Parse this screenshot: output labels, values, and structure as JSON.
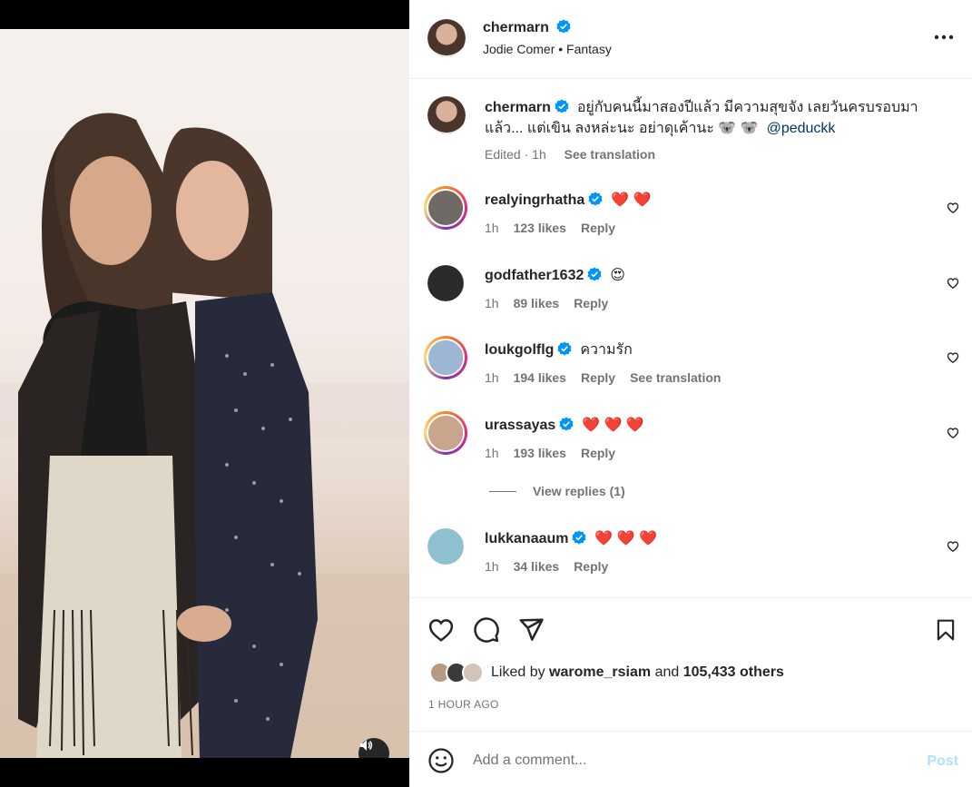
{
  "post": {
    "owner": {
      "username": "chermarn",
      "verified": true,
      "audio": "Jodie Comer • Fantasy"
    },
    "caption": {
      "username": "chermarn",
      "text": "อยู่กับคนนี้มาสองปีแล้ว มีความสุขจัง เลยวันครบรอบมาแล้ว... แต่เขิน ลงหล่ะนะ อย่าดุเค้านะ 🐨 🐨",
      "mention": "@peduckk",
      "edited": "Edited",
      "time": "1h",
      "see_translation": "See translation"
    },
    "comments": [
      {
        "username": "realyingrhatha",
        "text": "❤️ ❤️",
        "time": "1h",
        "likes": "123 likes",
        "reply": "Reply",
        "translation": "",
        "avatar_color": "#6f6a66",
        "story": true
      },
      {
        "username": "godfather1632",
        "text": "😍",
        "time": "1h",
        "likes": "89 likes",
        "reply": "Reply",
        "translation": "",
        "avatar_color": "#2b2b2b",
        "story": false
      },
      {
        "username": "loukgolflg",
        "text": "ความรัก",
        "time": "1h",
        "likes": "194 likes",
        "reply": "Reply",
        "translation": "See translation",
        "avatar_color": "#9bb7d4",
        "story": true
      },
      {
        "username": "urassayas",
        "text": "❤️ ❤️ ❤️",
        "time": "1h",
        "likes": "193 likes",
        "reply": "Reply",
        "translation": "",
        "avatar_color": "#c9a58c",
        "story": true
      },
      {
        "username": "lukkanaaum",
        "text": "❤️ ❤️ ❤️",
        "time": "1h",
        "likes": "34 likes",
        "reply": "Reply",
        "translation": "",
        "avatar_color": "#8fc0cf",
        "story": false
      }
    ],
    "view_replies": "View replies (1)",
    "liked_by": {
      "prefix": "Liked by",
      "user": "warome_rsiam",
      "and": "and",
      "others": "105,433 others"
    },
    "timestamp": "1 HOUR AGO",
    "comment_input_placeholder": "Add a comment...",
    "post_button": "Post"
  },
  "colors": {
    "verified_blue": "#0095f6",
    "post_button_disabled": "#b2dffc",
    "muted_text": "#737373"
  },
  "icons": [
    "heart-icon",
    "comment-icon",
    "share-icon",
    "bookmark-icon",
    "more-icon",
    "emoji-icon",
    "sound-icon",
    "verified-icon"
  ]
}
